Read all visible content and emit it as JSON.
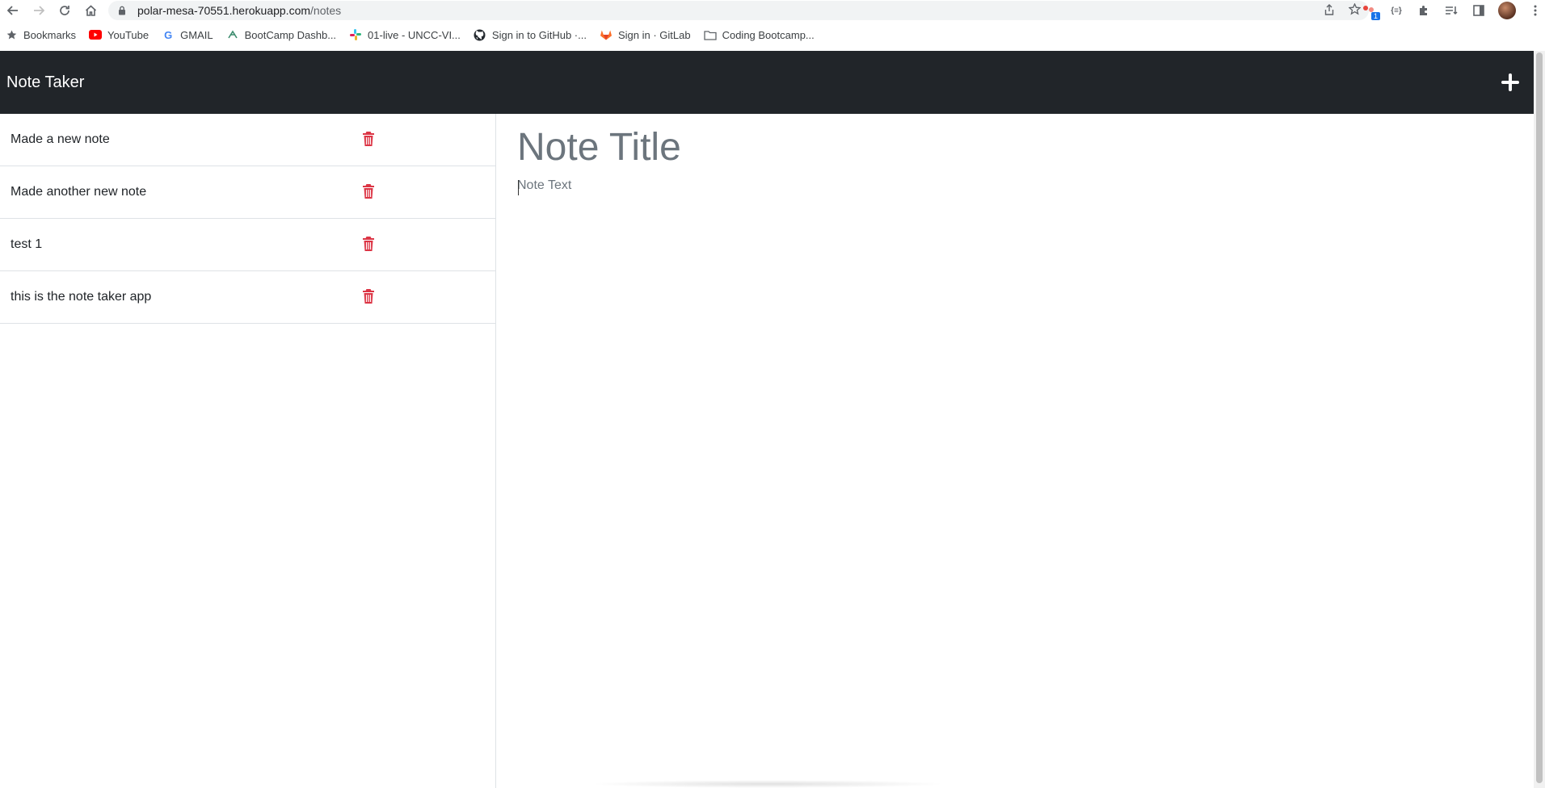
{
  "browser": {
    "url_host": "polar-mesa-70551.herokuapp.com",
    "url_path": "/notes",
    "extension_badge": "1",
    "ext_code_label": "{≡}",
    "bookmarks": [
      {
        "label": "Bookmarks",
        "icon": "star-icon"
      },
      {
        "label": "YouTube",
        "icon": "youtube-icon"
      },
      {
        "label": "GMAIL",
        "icon": "google-icon"
      },
      {
        "label": "BootCamp Dashb...",
        "icon": "bootcamp-icon"
      },
      {
        "label": "01-live - UNCC-VI...",
        "icon": "slack-icon"
      },
      {
        "label": "Sign in to GitHub ·...",
        "icon": "github-icon"
      },
      {
        "label": "Sign in · GitLab",
        "icon": "gitlab-icon"
      },
      {
        "label": "Coding Bootcamp...",
        "icon": "folder-icon"
      }
    ]
  },
  "app": {
    "brand": "Note Taker",
    "new_note_icon": "plus-icon",
    "delete_color": "#dc3545",
    "navbar_color": "#212529"
  },
  "notes": [
    {
      "title": "Made a new note"
    },
    {
      "title": "Made another new note"
    },
    {
      "title": "test 1"
    },
    {
      "title": "this is the note taker app"
    }
  ],
  "editor": {
    "title_placeholder": "Note Title",
    "text_placeholder": "Note Text"
  }
}
